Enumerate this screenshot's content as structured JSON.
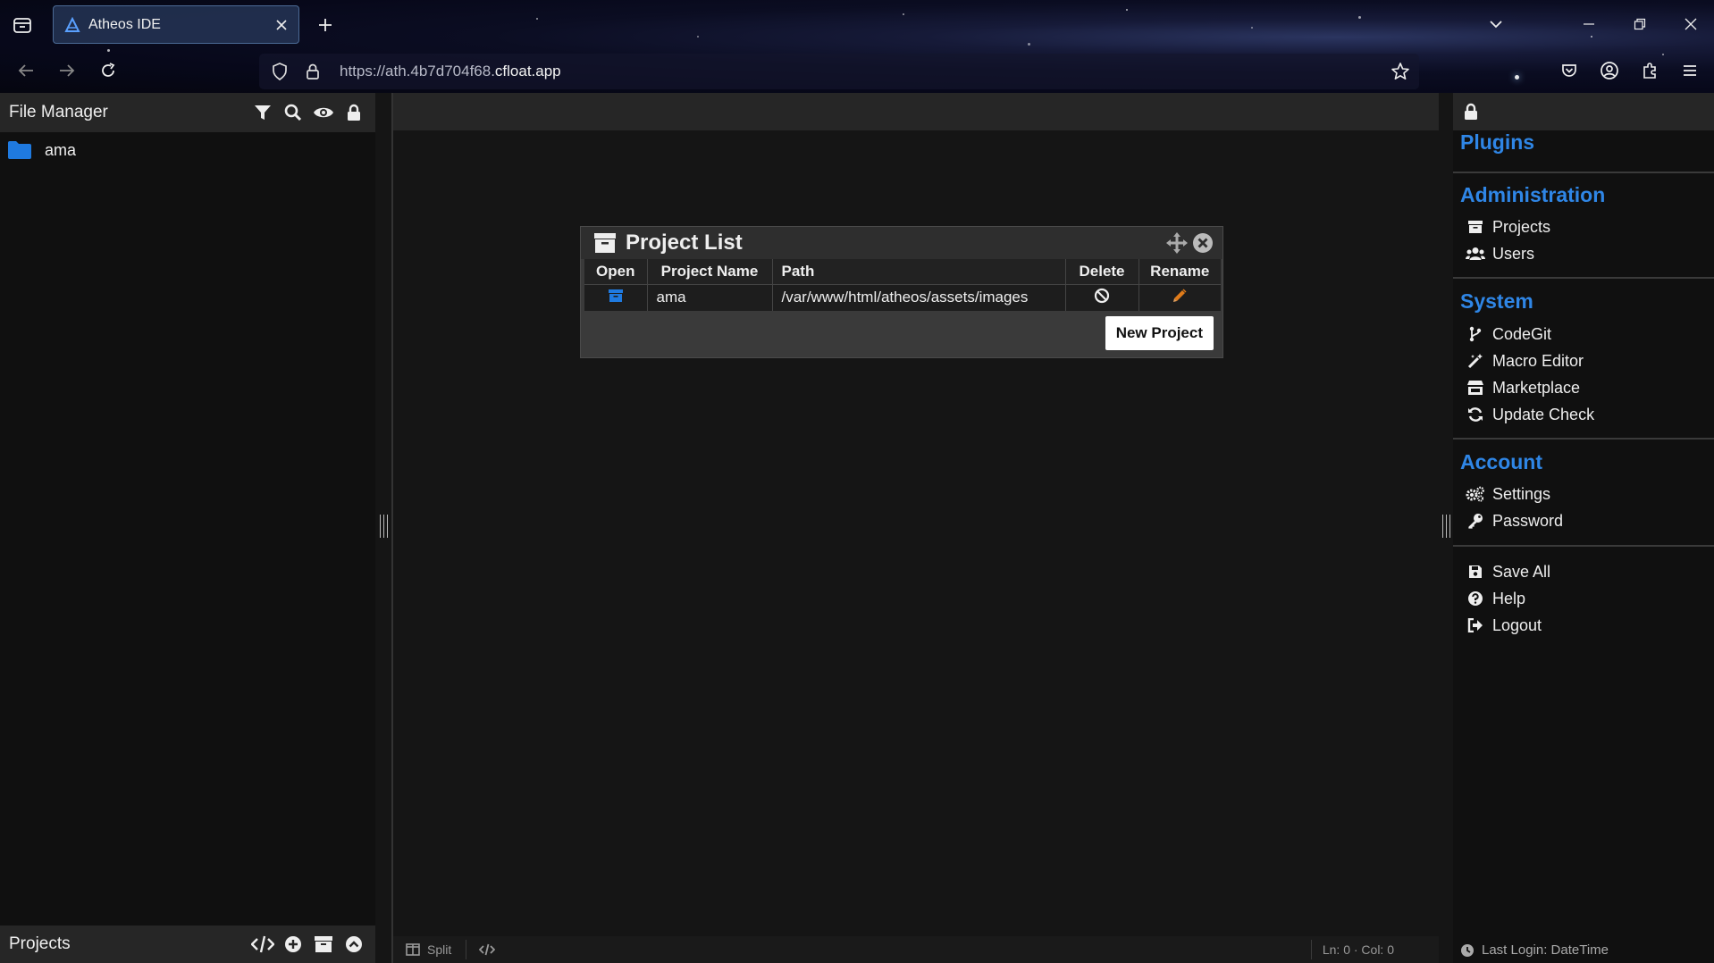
{
  "browser": {
    "tab_title": "Atheos IDE",
    "url_prefix": "https://ath.4b7d704f68.",
    "url_domain": "cfloat.app"
  },
  "file_manager": {
    "title": "File Manager",
    "tree": [
      {
        "label": "ama",
        "icon": "folder-icon"
      }
    ],
    "header_icons": [
      "filter-icon",
      "search-icon",
      "eye-icon",
      "lock-icon"
    ]
  },
  "projects_footer": {
    "title": "Projects",
    "icons": [
      "code-icon",
      "plus-circle-icon",
      "archive-icon",
      "chevron-up-circle-icon"
    ]
  },
  "modal": {
    "title": "Project List",
    "columns": [
      "Open",
      "Project Name",
      "Path",
      "Delete",
      "Rename"
    ],
    "rows": [
      {
        "name": "ama",
        "path": "/var/www/html/atheos/assets/images"
      }
    ],
    "new_project_label": "New Project"
  },
  "status_bar": {
    "split_label": "Split",
    "position": "Ln: 0 · Col: 0"
  },
  "right_panel": {
    "plugins_title": "Plugins",
    "administration": {
      "title": "Administration",
      "items": [
        {
          "label": "Projects",
          "icon": "archive-icon"
        },
        {
          "label": "Users",
          "icon": "users-icon"
        }
      ]
    },
    "system": {
      "title": "System",
      "items": [
        {
          "label": "CodeGit",
          "icon": "branch-icon"
        },
        {
          "label": "Macro Editor",
          "icon": "magic-wand-icon"
        },
        {
          "label": "Marketplace",
          "icon": "store-icon"
        },
        {
          "label": "Update Check",
          "icon": "refresh-icon"
        }
      ]
    },
    "account": {
      "title": "Account",
      "items": [
        {
          "label": "Settings",
          "icon": "gears-icon"
        },
        {
          "label": "Password",
          "icon": "key-icon"
        }
      ]
    },
    "misc": {
      "items": [
        {
          "label": "Save All",
          "icon": "save-icon"
        },
        {
          "label": "Help",
          "icon": "help-icon"
        },
        {
          "label": "Logout",
          "icon": "logout-icon"
        }
      ]
    },
    "last_login": "Last Login: DateTime"
  },
  "colors": {
    "accent": "#2f86e6",
    "rename_icon": "#e07b1a",
    "folder": "#1f7ae0"
  }
}
